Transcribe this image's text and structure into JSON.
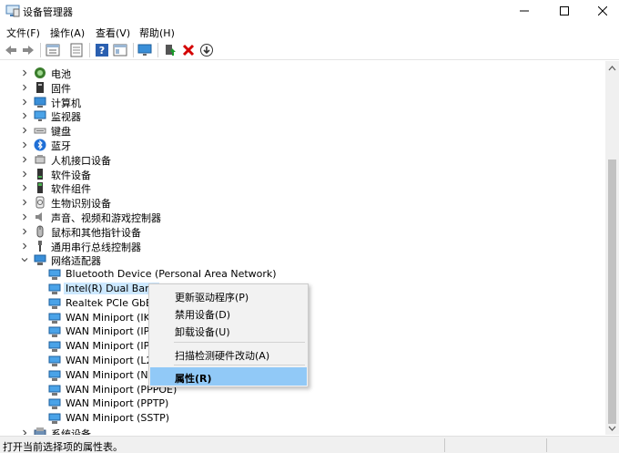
{
  "window": {
    "title": "设备管理器",
    "min_icon": "minimize-icon",
    "max_icon": "maximize-icon",
    "close_icon": "close-icon"
  },
  "menubar": [
    "文件(F)",
    "操作(A)",
    "查看(V)",
    "帮助(H)"
  ],
  "toolbar": [
    "back-icon",
    "forward-icon",
    "tree-view-icon",
    "properties-icon",
    "help-icon",
    "details-icon",
    "monitor-icon",
    "update-driver-icon",
    "uninstall-icon",
    "download-icon"
  ],
  "tree": {
    "categories": [
      {
        "label": "电池",
        "icon": "battery-icon"
      },
      {
        "label": "固件",
        "icon": "firmware-icon"
      },
      {
        "label": "计算机",
        "icon": "computer-icon"
      },
      {
        "label": "监视器",
        "icon": "monitor-icon"
      },
      {
        "label": "键盘",
        "icon": "keyboard-icon"
      },
      {
        "label": "蓝牙",
        "icon": "bluetooth-icon"
      },
      {
        "label": "人机接口设备",
        "icon": "hid-icon"
      },
      {
        "label": "软件设备",
        "icon": "software-device-icon"
      },
      {
        "label": "软件组件",
        "icon": "software-component-icon"
      },
      {
        "label": "生物识别设备",
        "icon": "biometric-icon"
      },
      {
        "label": "声音、视频和游戏控制器",
        "icon": "speaker-icon"
      },
      {
        "label": "鼠标和其他指针设备",
        "icon": "mouse-icon"
      },
      {
        "label": "通用串行总线控制器",
        "icon": "usb-icon"
      },
      {
        "label": "网络适配器",
        "icon": "network-adapter-icon",
        "expanded": true
      }
    ],
    "network_children": [
      "Bluetooth Device (Personal Area Network)",
      "Intel(R) Dual Band",
      "Realtek PCIe GbE F",
      "WAN Miniport (IKE",
      "WAN Miniport (IP)",
      "WAN Miniport (IPv",
      "WAN Miniport (L2T",
      "WAN Miniport (Ne",
      "WAN Miniport (PPPOE)",
      "WAN Miniport (PPTP)",
      "WAN Miniport (SSTP)"
    ],
    "selected_child": 1,
    "bottom_category": {
      "label": "系统设备",
      "icon": "system-device-icon"
    }
  },
  "context_menu": {
    "items": [
      "更新驱动程序(P)",
      "禁用设备(D)",
      "卸载设备(U)",
      "扫描检测硬件改动(A)",
      "属性(R)"
    ],
    "highlighted": 4
  },
  "status": {
    "text": "打开当前选择项的属性表。"
  },
  "colors": {
    "selection": "#cce8ff",
    "menu_highlight": "#91c9f7",
    "uninstall_red": "#d40000",
    "update_green": "#1a9a2a"
  }
}
